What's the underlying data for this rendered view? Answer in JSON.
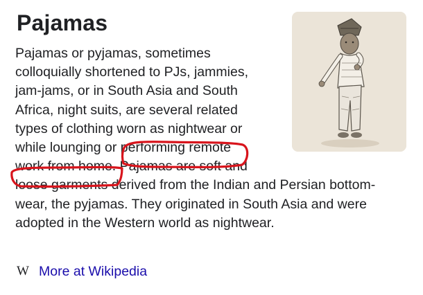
{
  "panel": {
    "title": "Pajamas",
    "description_lines": [
      "Pajamas or pyjamas, sometimes",
      "colloquially shortened to PJs, jammies,",
      "jam-jams, or in South Asia and South",
      "Africa, night suits, are several related",
      "types of clothing worn as nightwear or",
      "while lounging or performing remote",
      "work from home. Pajamas are soft and",
      "loose garments derived from the Indian and Persian bottom-",
      "wear, the pyjamas. They originated in South Asia and were",
      "adopted in the Western world as nightwear."
    ],
    "image_icon": "child-in-pajamas-illustration",
    "more_link": {
      "icon": "W",
      "label": "More at Wikipedia"
    }
  },
  "annotation": {
    "color": "#d8141c",
    "icon": "red-freehand-outline"
  }
}
